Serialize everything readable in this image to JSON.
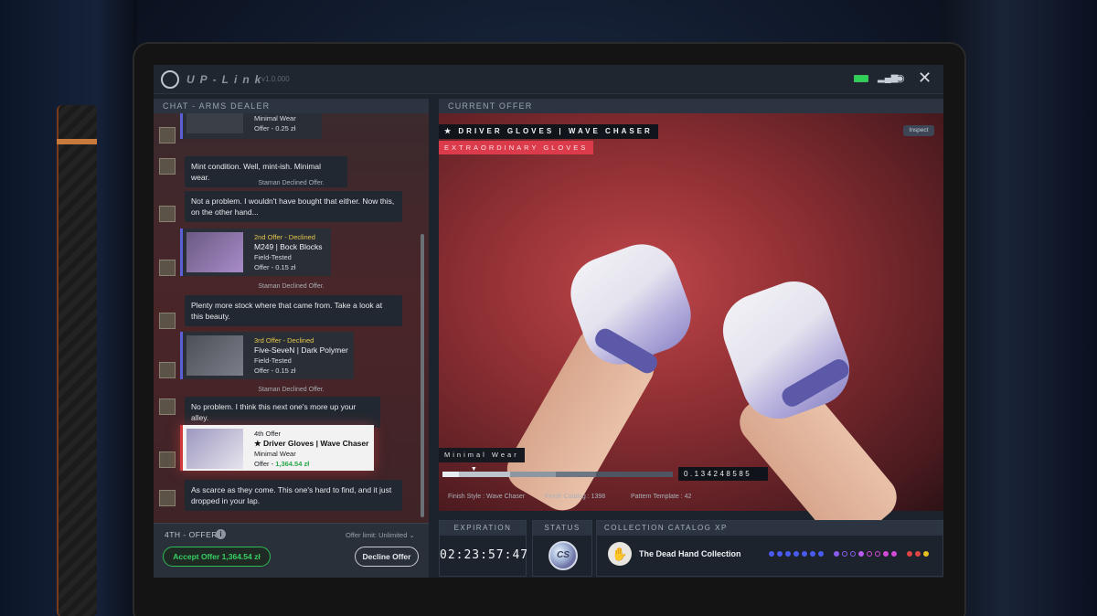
{
  "app": {
    "brand": "UP-Link",
    "version": "v1.0.000"
  },
  "chat": {
    "header": "CHAT - ARMS DEALER",
    "first_card": {
      "wear": "Minimal Wear",
      "price": "Offer - 0.25 zł"
    },
    "msg1": "Mint condition. Well, mint-ish. Minimal wear.",
    "sys1": "Staman Declined Offer.",
    "msg2": "Not a problem. I wouldn't have bought that either. Now this, on the other hand...",
    "card2": {
      "status": "2nd Offer - Declined",
      "name": "M249 | Bock Blocks",
      "wear": "Field-Tested",
      "price": "Offer - 0.15 zł"
    },
    "sys2": "Staman Declined Offer.",
    "msg3": "Plenty more stock where that came from. Take a look at this beauty.",
    "card3": {
      "status": "3rd Offer - Declined",
      "name": "Five-SeveN | Dark Polymer",
      "wear": "Field-Tested",
      "price": "Offer - 0.15 zł"
    },
    "sys3": "Staman Declined Offer.",
    "msg4": "No problem. I think this next one's more up your alley.",
    "card4": {
      "status": "4th Offer",
      "name": "★ Driver Gloves | Wave Chaser",
      "wear": "Minimal Wear",
      "price_prefix": "Offer - ",
      "price": "1,364.54 zł"
    },
    "msg5": "As scarce as they come. This one's hard to find, and it just dropped in your lap."
  },
  "footer": {
    "offer_label": "4TH - OFFER",
    "info_icon": "i",
    "limit": "Offer limit: Unlimited ⌄",
    "accept": "Accept Offer 1,364.54 zł",
    "decline": "Decline Offer"
  },
  "offer": {
    "header": "CURRENT OFFER",
    "title": "★ DRIVER GLOVES | WAVE CHASER",
    "rarity": "EXTRAORDINARY GLOVES",
    "inspect": "Inspect",
    "wear_label": "Minimal Wear",
    "wear_fraction": 0.1342,
    "float_value": "0.134248585",
    "finish_style": "Finish Style : Wave Chaser",
    "catalog": "Finish Catalog : 1398",
    "pattern": "Pattern Template : 42"
  },
  "expiration": {
    "header": "EXPIRATION",
    "time": "02:23:57:47"
  },
  "status": {
    "header": "STATUS",
    "badge": "CS"
  },
  "collection": {
    "header": "COLLECTION CATALOG XP",
    "name": "The Dead Hand Collection",
    "hand_glyph": "✋"
  },
  "colors": {
    "accent_red": "#dc3b4b",
    "accept_green": "#2dbb55",
    "dots": [
      "#4a5cf0",
      "#4a5cf0",
      "#4a5cf0",
      "#4a5cf0",
      "#4a5cf0",
      "#4a5cf0",
      "#4a5cf0",
      "#8a5cf0",
      "#8a5cf0",
      "#8a5cf0",
      "#b85cf0",
      "#d24ad6",
      "#d24ad6",
      "#d24ad6",
      "#d24ad6",
      "#e04444",
      "#e04444",
      "#e8c020"
    ]
  }
}
